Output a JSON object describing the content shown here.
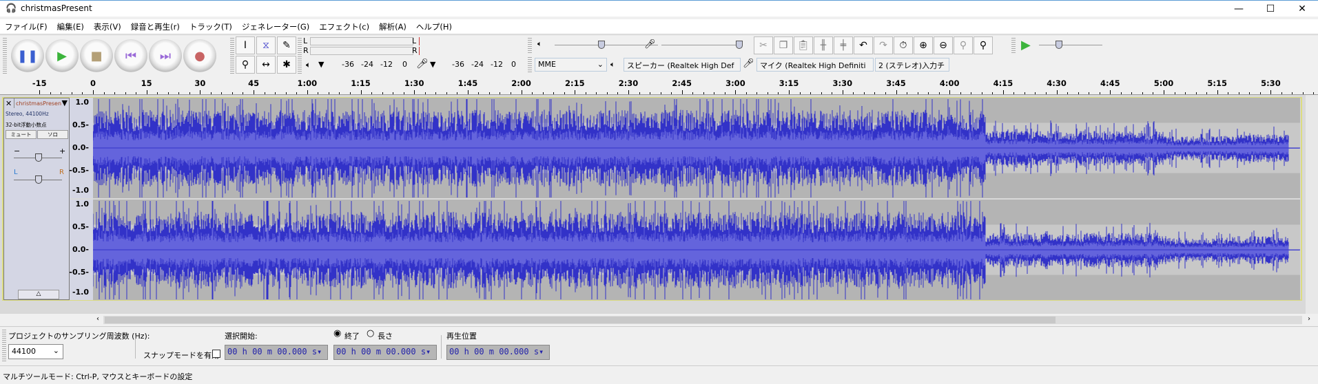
{
  "window": {
    "title": "christmasPresent",
    "min": "—",
    "max": "☐",
    "close": "✕"
  },
  "menu": [
    "ファイル(F)",
    "編集(E)",
    "表示(V)",
    "録音と再生(r)",
    "トラック(T)",
    "ジェネレーター(G)",
    "エフェクト(c)",
    "解析(A)",
    "ヘルプ(H)"
  ],
  "meters": {
    "L": "L",
    "R": "R",
    "play_ticks": [
      "-36",
      "-24",
      "-12",
      "0"
    ],
    "rec_ticks": [
      "-36",
      "-24",
      "-12",
      "0"
    ]
  },
  "devices": {
    "host": "MME",
    "output": "スピーカー (Realtek High Def",
    "input": "マイク (Realtek High Definiti",
    "channels": "2 (ステレオ)入力チ"
  },
  "ruler": [
    "-15",
    "0",
    "15",
    "30",
    "45",
    "1:00",
    "1:15",
    "1:30",
    "1:45",
    "2:00",
    "2:15",
    "2:30",
    "2:45",
    "3:00",
    "3:15",
    "3:30",
    "3:45",
    "4:00",
    "4:15",
    "4:30",
    "4:45",
    "5:00",
    "5:15",
    "5:30"
  ],
  "track": {
    "name": "christmasPresen",
    "info1": "Stereo, 44100Hz",
    "info2": "32-bit浮動小数点",
    "mute": "ミュート",
    "solo": "ソロ",
    "gain_minus": "−",
    "gain_plus": "+",
    "pan_l": "L",
    "pan_r": "R",
    "scale": [
      "1.0",
      "0.5",
      "0.0",
      "-0.5",
      "-1.0"
    ]
  },
  "colors": {
    "wave": "#3232c8",
    "wave_rms": "#6464dc",
    "background": "#b4b4b4",
    "selected_border": "#dcdc80"
  },
  "bottom": {
    "rate_label": "プロジェクトのサンプリング周波数 (Hz):",
    "rate_value": "44100",
    "snap_label": "スナップモードを有効",
    "sel_start_label": "選択開始:",
    "end_label": "終了",
    "length_label": "長さ",
    "play_pos_label": "再生位置",
    "sel_start": "00 h 00 m 00.000 s",
    "sel_end": "00 h 00 m 00.000 s",
    "play_pos": "00 h 00 m 00.000 s"
  },
  "status": "マルチツールモード: Ctrl-P, マウスとキーボードの設定"
}
